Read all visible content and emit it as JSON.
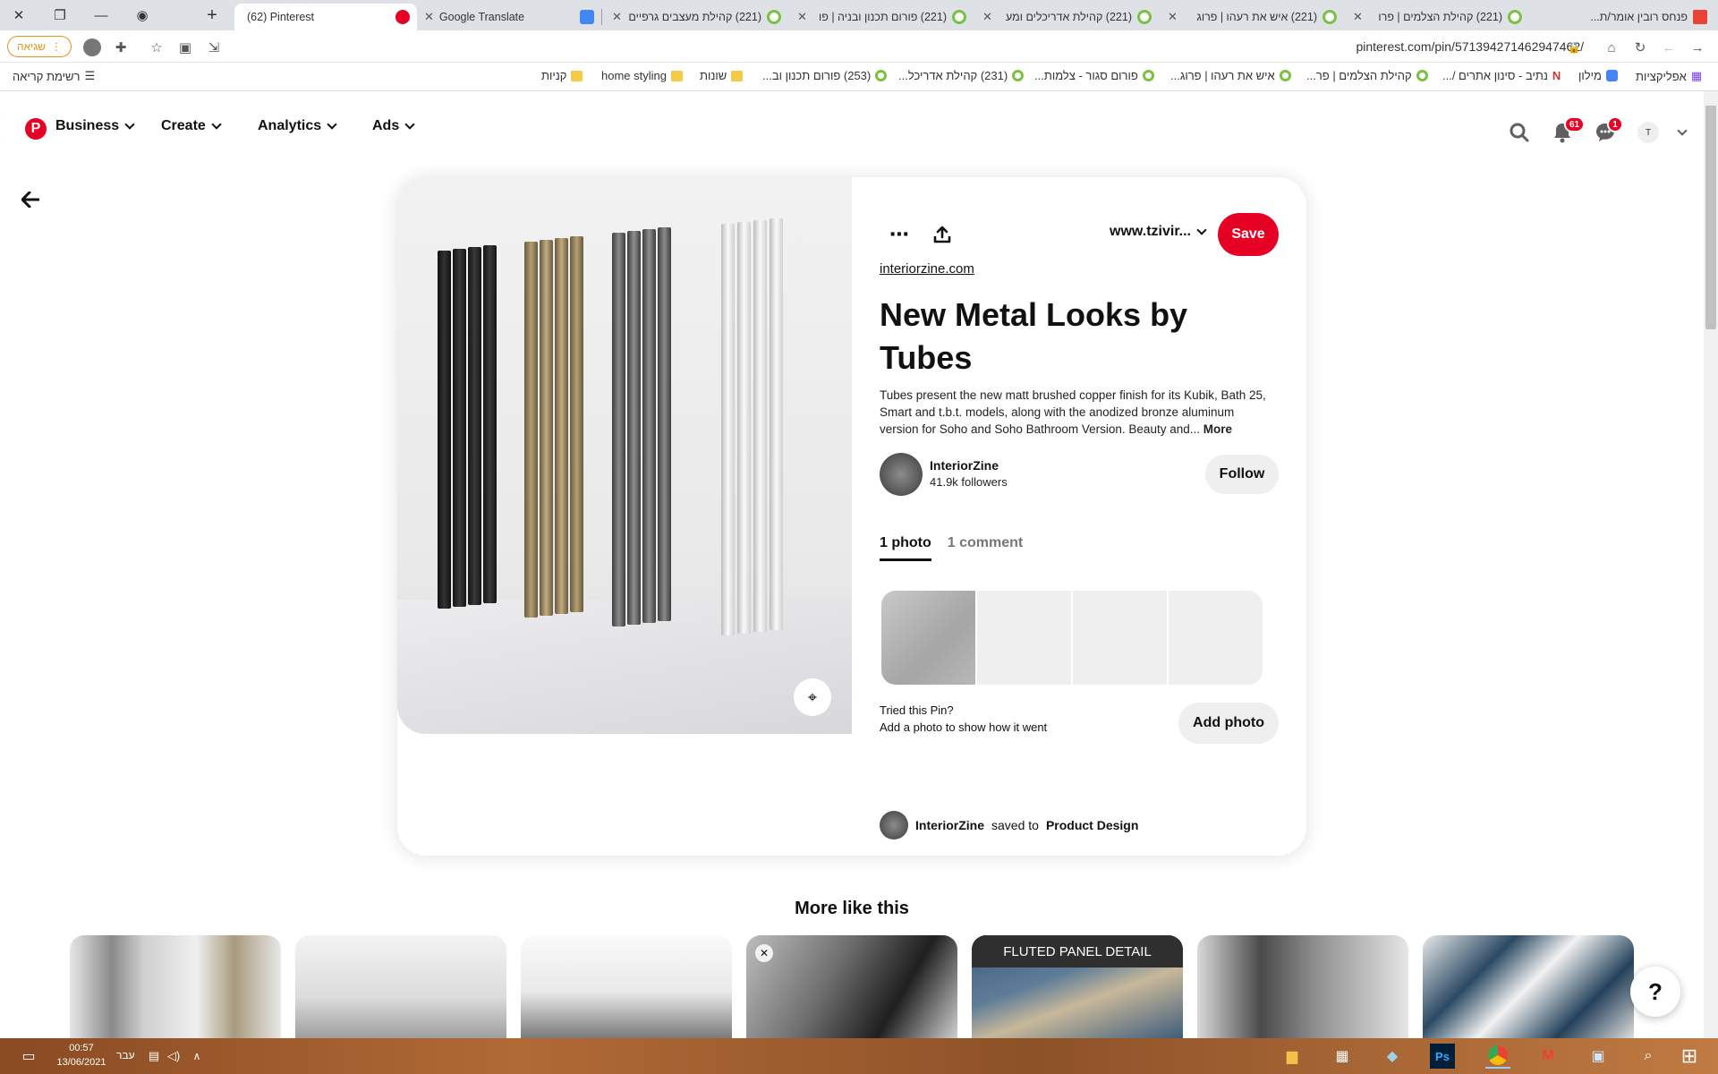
{
  "browser": {
    "tabs": [
      {
        "title": "(62) Pinterest",
        "icon": "pinterest-icon",
        "active": true
      },
      {
        "title": "Google Translate",
        "icon": "google-translate-icon"
      },
      {
        "title": "(221) קהילת מעצבים גרפיים",
        "icon": "community-icon"
      },
      {
        "title": "(221) פורום תכנון ובניה | פו",
        "icon": "community-icon"
      },
      {
        "title": "(221) קהילת אדריכלים ומע",
        "icon": "community-icon"
      },
      {
        "title": "(221) איש את רעהו | פרוג",
        "icon": "community-icon"
      },
      {
        "title": "(221) קהילת הצלמים | פרו",
        "icon": "community-icon"
      },
      {
        "title": "פנחס רובין אומר/ת...",
        "icon": "gmail-icon"
      }
    ],
    "error_chip": "שגיאה",
    "url": "pinterest.com/pin/571394271462947462/",
    "bookmarks": {
      "apps": "אפליקציות",
      "reading_list": "רשימת קריאה",
      "items": [
        "מילון",
        "נתיב - סינון אתרים /...",
        "קהילת הצלמים | פר...",
        "איש את רעהו | פרוג...",
        "פורום סגור - צלמות...",
        "(231) קהילת אדריכל...",
        "(253) פורום תכנון וב...",
        "שונות",
        "home styling",
        "קניות"
      ]
    }
  },
  "pinterest_nav": {
    "items": [
      "Business",
      "Create",
      "Analytics",
      "Ads"
    ],
    "notifications_count": "61",
    "messages_count": "1",
    "avatar_letter": "T"
  },
  "pin": {
    "site": "www.tzivir...",
    "save_label": "Save",
    "domain": "interiorzine.com",
    "title": "New Metal Looks by Tubes",
    "description": "Tubes present the new matt brushed copper finish for its Kubik, Bath 25, Smart and t.b.t. models, along with the anodized bronze aluminum version for Soho and Soho Bathroom Version. Beauty and...",
    "more_label": "More",
    "author": "InteriorZine",
    "followers": "41.9k followers",
    "follow_label": "Follow",
    "tab_photos": "1 photo",
    "tab_comments": "1 comment",
    "tried_title": "Tried this Pin?",
    "tried_sub": "Add a photo to show how it went",
    "add_photo_label": "Add photo",
    "saved_by": "InteriorZine",
    "saved_to_text": "saved to",
    "board": "Product Design"
  },
  "more_like_this": {
    "heading": "More like this",
    "card_caption": "FLUTED PANEL DETAIL"
  },
  "help_label": "?",
  "taskbar": {
    "time": "00:57",
    "date": "13/06/2021",
    "lang": "עבר"
  },
  "colors": {
    "pinterest_red": "#e60023",
    "community_green": "#7ac143"
  }
}
